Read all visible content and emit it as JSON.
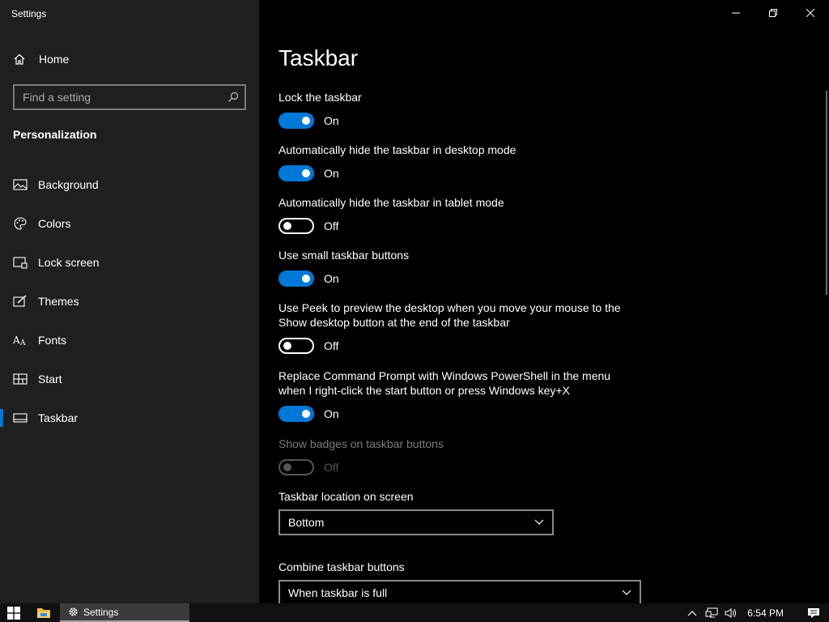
{
  "window": {
    "title": "Settings"
  },
  "sidebar": {
    "home_label": "Home",
    "search_placeholder": "Find a setting",
    "section_title": "Personalization",
    "items": [
      {
        "label": "Background",
        "icon": "image-icon"
      },
      {
        "label": "Colors",
        "icon": "palette-icon"
      },
      {
        "label": "Lock screen",
        "icon": "lock-screen-icon"
      },
      {
        "label": "Themes",
        "icon": "themes-icon"
      },
      {
        "label": "Fonts",
        "icon": "fonts-icon"
      },
      {
        "label": "Start",
        "icon": "start-icon"
      },
      {
        "label": "Taskbar",
        "icon": "taskbar-icon",
        "selected": true
      }
    ]
  },
  "main": {
    "title": "Taskbar",
    "settings": [
      {
        "label": "Lock the taskbar",
        "state": "On"
      },
      {
        "label": "Automatically hide the taskbar in desktop mode",
        "state": "On"
      },
      {
        "label": "Automatically hide the taskbar in tablet mode",
        "state": "Off"
      },
      {
        "label": "Use small taskbar buttons",
        "state": "On"
      },
      {
        "label_line1": "Use Peek to preview the desktop when you move your mouse to the",
        "label_line2": "Show desktop button at the end of the taskbar",
        "state": "Off"
      },
      {
        "label_line1": "Replace Command Prompt with Windows PowerShell in the menu",
        "label_line2": "when I right-click the start button or press Windows key+X",
        "state": "On"
      },
      {
        "label": "Show badges on taskbar buttons",
        "state": "Off",
        "disabled": true
      }
    ],
    "location": {
      "label": "Taskbar location on screen",
      "value": "Bottom"
    },
    "combine": {
      "label": "Combine taskbar buttons",
      "value": "When taskbar is full"
    }
  },
  "taskbar": {
    "settings_app_label": "Settings",
    "clock": "6:54 PM"
  },
  "colors": {
    "accent": "#0078d7",
    "sidebar_bg": "#1f1f1f",
    "main_bg": "#000000"
  }
}
